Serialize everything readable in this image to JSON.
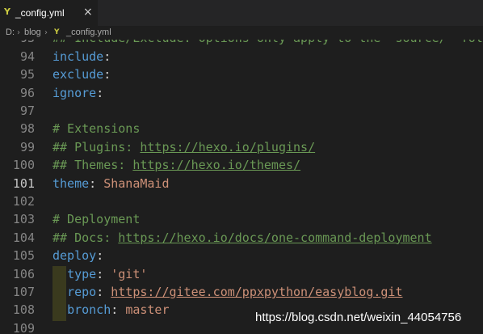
{
  "tab": {
    "icon": "yaml-file-icon",
    "title": "_config.yml"
  },
  "breadcrumb": {
    "drive": "D:",
    "folder": "blog",
    "file": "_config.yml"
  },
  "lines": [
    {
      "num": "93",
      "parts": [
        {
          "t": "## Include/Exclude: Options only apply to the 'source/' folder",
          "c": "cmt"
        }
      ]
    },
    {
      "num": "94",
      "parts": [
        {
          "t": "include",
          "c": "key"
        },
        {
          "t": ":",
          "c": "punc"
        }
      ]
    },
    {
      "num": "95",
      "parts": [
        {
          "t": "exclude",
          "c": "key"
        },
        {
          "t": ":",
          "c": "punc"
        }
      ]
    },
    {
      "num": "96",
      "parts": [
        {
          "t": "ignore",
          "c": "key"
        },
        {
          "t": ":",
          "c": "punc"
        }
      ]
    },
    {
      "num": "97",
      "parts": []
    },
    {
      "num": "98",
      "parts": [
        {
          "t": "# Extensions",
          "c": "cmt"
        }
      ]
    },
    {
      "num": "99",
      "parts": [
        {
          "t": "## Plugins: ",
          "c": "cmt"
        },
        {
          "t": "https://hexo.io/plugins/",
          "c": "link"
        }
      ]
    },
    {
      "num": "100",
      "parts": [
        {
          "t": "## Themes: ",
          "c": "cmt"
        },
        {
          "t": "https://hexo.io/themes/",
          "c": "link"
        }
      ]
    },
    {
      "num": "101",
      "active": true,
      "parts": [
        {
          "t": "theme",
          "c": "key"
        },
        {
          "t": ": ",
          "c": "punc"
        },
        {
          "t": "ShanaMaid",
          "c": "val"
        }
      ]
    },
    {
      "num": "102",
      "parts": []
    },
    {
      "num": "103",
      "parts": [
        {
          "t": "# Deployment",
          "c": "cmt"
        }
      ]
    },
    {
      "num": "104",
      "parts": [
        {
          "t": "## Docs: ",
          "c": "cmt"
        },
        {
          "t": "https://hexo.io/docs/one-command-deployment",
          "c": "link"
        }
      ]
    },
    {
      "num": "105",
      "parts": [
        {
          "t": "deploy",
          "c": "key"
        },
        {
          "t": ":",
          "c": "punc"
        }
      ]
    },
    {
      "num": "106",
      "parts": [
        {
          "t": "  ",
          "c": "punc"
        },
        {
          "t": "type",
          "c": "key"
        },
        {
          "t": ": ",
          "c": "punc"
        },
        {
          "t": "'git'",
          "c": "val"
        }
      ]
    },
    {
      "num": "107",
      "parts": [
        {
          "t": "  ",
          "c": "punc"
        },
        {
          "t": "repo",
          "c": "key"
        },
        {
          "t": ": ",
          "c": "punc"
        },
        {
          "t": "https://gitee.com/ppxpython/easyblog.git",
          "c": "vlink"
        }
      ]
    },
    {
      "num": "108",
      "parts": [
        {
          "t": "  ",
          "c": "punc"
        },
        {
          "t": "bronch",
          "c": "key"
        },
        {
          "t": ": ",
          "c": "punc"
        },
        {
          "t": "master",
          "c": "val"
        }
      ]
    },
    {
      "num": "109",
      "parts": []
    }
  ],
  "watermark": "https://blog.csdn.net/weixin_44054756",
  "colors": {
    "background": "#1e1e1e",
    "key": "#569cd6",
    "string": "#ce9178",
    "comment": "#6a9955",
    "yaml_icon": "#cbcb41"
  }
}
